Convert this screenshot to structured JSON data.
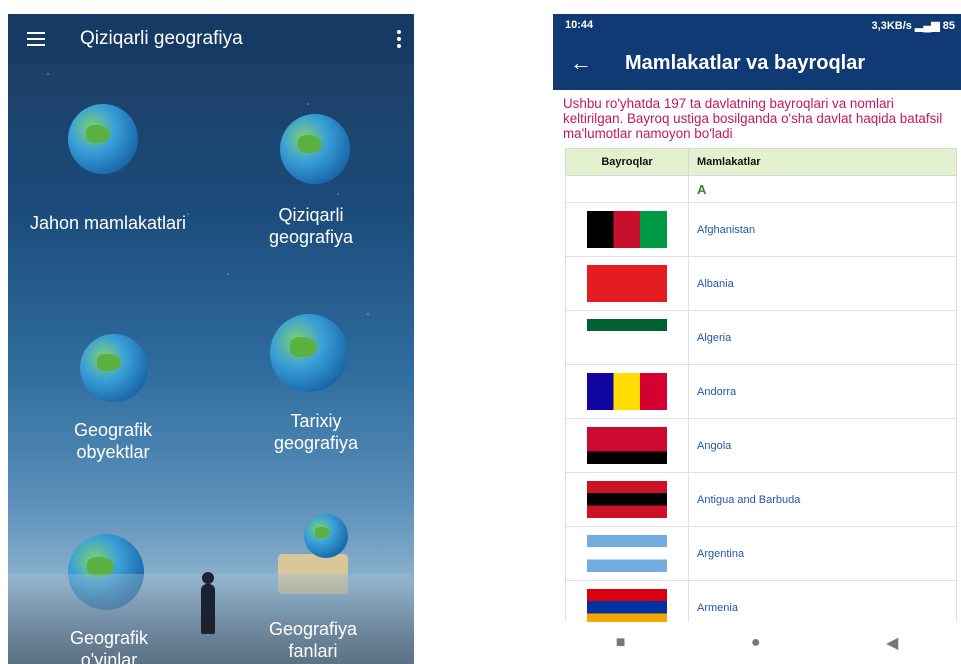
{
  "left_app": {
    "title": "Qiziqarli geografiya",
    "menu_icon": "hamburger-icon",
    "more_icon": "more-vert-icon",
    "tiles": [
      {
        "label": "Jahon mamlakatlari"
      },
      {
        "label": "Qiziqarli geografiya"
      },
      {
        "label": "Geografik obyektlar"
      },
      {
        "label": "Tarixiy geografiya"
      },
      {
        "label": "Geografik o'yinlar"
      },
      {
        "label": "Geografiya fanlari"
      }
    ]
  },
  "right_app": {
    "status": {
      "time": "10:44",
      "right": "3,3KB/s",
      "battery": "85"
    },
    "title": "Mamlakatlar va bayroqlar",
    "intro": "Ushbu ro'yhatda 197 ta davlatning bayroqlari va nomlari keltirilgan. Bayroq ustiga bosilganda o'sha davlat haqida batafsil ma'lumotlar namoyon bo'ladi",
    "columns": [
      "Bayroqlar",
      "Mamlakatlar"
    ],
    "letter": "A",
    "countries": [
      {
        "name": "Afghanistan",
        "colors": [
          "#000000",
          "#c8102e",
          "#009a44"
        ]
      },
      {
        "name": "Albania",
        "colors": [
          "#e41e20",
          "#e41e20",
          "#e41e20"
        ]
      },
      {
        "name": "Algeria",
        "colors": [
          "#006233",
          "#ffffff",
          "#ffffff"
        ]
      },
      {
        "name": "Andorra",
        "colors": [
          "#10069f",
          "#fedd00",
          "#d50032"
        ]
      },
      {
        "name": "Angola",
        "colors": [
          "#cc092f",
          "#cc092f",
          "#000000"
        ]
      },
      {
        "name": "Antigua and Barbuda",
        "colors": [
          "#ce1126",
          "#000000",
          "#ce1126"
        ]
      },
      {
        "name": "Argentina",
        "colors": [
          "#74acdf",
          "#ffffff",
          "#74acdf"
        ]
      },
      {
        "name": "Armenia",
        "colors": [
          "#d90012",
          "#0033a0",
          "#f2a800"
        ]
      }
    ],
    "nav_icons": [
      "square-icon",
      "circle-icon",
      "back-triangle-icon"
    ]
  }
}
